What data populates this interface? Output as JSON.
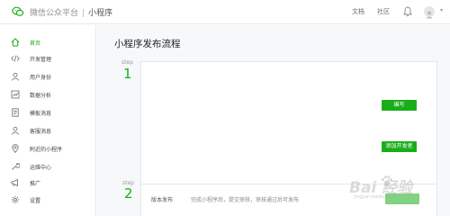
{
  "header": {
    "brand": "微信公众平台",
    "separator": "|",
    "title": "小程序",
    "docs": "文档",
    "community": "社区"
  },
  "sidebar": {
    "items": [
      {
        "label": "首页",
        "icon": "home-icon",
        "active": true
      },
      {
        "label": "开发管理",
        "icon": "code-icon"
      },
      {
        "label": "用户身份",
        "icon": "user-icon"
      },
      {
        "label": "数据分析",
        "icon": "chart-icon"
      },
      {
        "label": "模板消息",
        "icon": "document-icon"
      },
      {
        "label": "客服消息",
        "icon": "customer-service-icon"
      },
      {
        "label": "附近的小程序",
        "icon": "location-icon"
      },
      {
        "label": "运维中心",
        "icon": "wrench-icon"
      },
      {
        "label": "推广",
        "icon": "megaphone-icon"
      },
      {
        "label": "设置",
        "icon": "gear-icon"
      }
    ]
  },
  "main": {
    "title": "小程序发布流程",
    "steps": [
      {
        "label": "step",
        "number": "1",
        "buttons": [
          "编写",
          "添加开发者"
        ]
      },
      {
        "label": "step",
        "number": "2",
        "row_title": "版本发布",
        "row_desc": "完成小程序后，提交审核，审核通过后可发布"
      }
    ]
  },
  "watermark": {
    "text": "Bai  经验",
    "sub": "jingyan.baidu.com"
  },
  "colors": {
    "accent": "#1aad19",
    "background": "#f6f8f9"
  }
}
